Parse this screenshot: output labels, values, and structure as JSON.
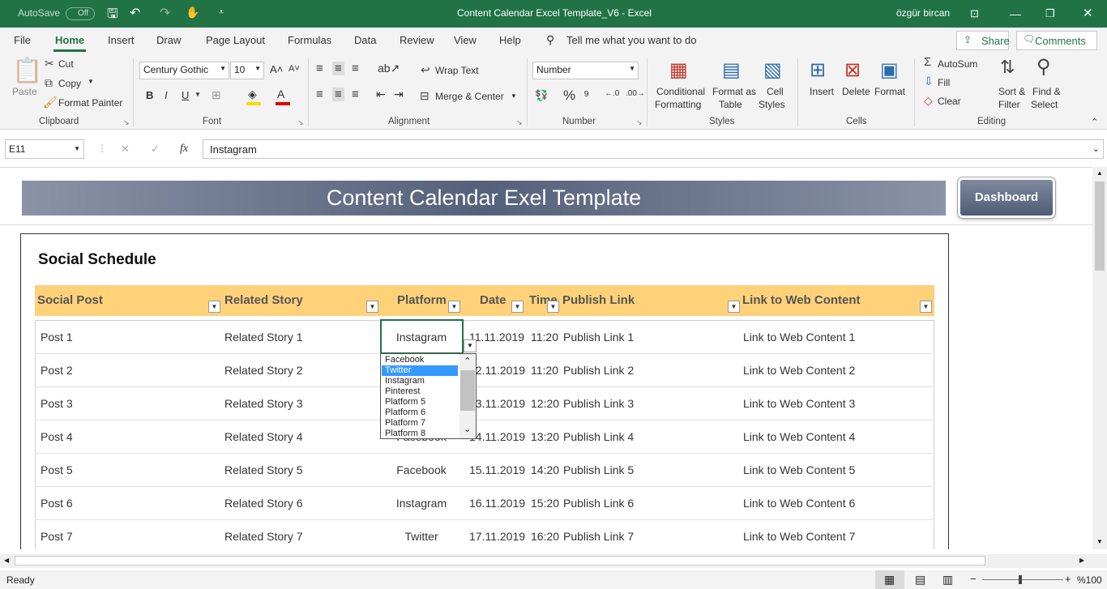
{
  "titlebar": {
    "autosave_label": "AutoSave",
    "autosave_state": "Off",
    "title": "Content Calendar Excel Template_V6  -  Excel",
    "user": "özgür bircan"
  },
  "menu": {
    "tabs": [
      "File",
      "Home",
      "Insert",
      "Draw",
      "Page Layout",
      "Formulas",
      "Data",
      "Review",
      "View",
      "Help"
    ],
    "active": "Home",
    "tell_me": "Tell me what you want to do",
    "share": "Share",
    "comments": "Comments"
  },
  "ribbon": {
    "clipboard": {
      "paste": "Paste",
      "cut": "Cut",
      "copy": "Copy",
      "format_painter": "Format Painter",
      "group": "Clipboard"
    },
    "font": {
      "name": "Century Gothic",
      "size": "10",
      "bold": "B",
      "italic": "I",
      "underline": "U",
      "group": "Font"
    },
    "alignment": {
      "wrap": "Wrap Text",
      "merge": "Merge & Center",
      "group": "Alignment"
    },
    "number": {
      "format": "Number",
      "group": "Number"
    },
    "styles": {
      "conditional_1": "Conditional",
      "conditional_2": "Formatting",
      "table_1": "Format as",
      "table_2": "Table",
      "cell_1": "Cell",
      "cell_2": "Styles",
      "group": "Styles"
    },
    "cells": {
      "insert": "Insert",
      "delete": "Delete",
      "format": "Format",
      "group": "Cells"
    },
    "editing": {
      "autosum": "AutoSum",
      "fill": "Fill",
      "clear": "Clear",
      "sort_1": "Sort &",
      "sort_2": "Filter",
      "find_1": "Find &",
      "find_2": "Select",
      "group": "Editing"
    }
  },
  "formula_bar": {
    "name_box": "E11",
    "fx": "fx",
    "value": "Instagram"
  },
  "sheet": {
    "banner": "Content Calendar Exel Template",
    "dashboard_button": "Dashboard",
    "section_title": "Social Schedule",
    "headers": [
      "Social Post",
      "Related Story",
      "Platform",
      "Date",
      "Time",
      "Publish Link",
      "Link to Web Content"
    ],
    "rows": [
      {
        "post": "Post 1",
        "story": "Related Story 1",
        "platform": "Instagram",
        "date": "11.11.2019",
        "time": "11:20",
        "publish": "Publish Link 1",
        "web": "Link to Web Content 1"
      },
      {
        "post": "Post 2",
        "story": "Related Story 2",
        "platform": "",
        "date": "12.11.2019",
        "time": "11:20",
        "publish": "Publish Link 2",
        "web": "Link to Web Content 2"
      },
      {
        "post": "Post 3",
        "story": "Related Story 3",
        "platform": "",
        "date": "13.11.2019",
        "time": "12:20",
        "publish": "Publish Link 3",
        "web": "Link to Web Content 3"
      },
      {
        "post": "Post 4",
        "story": "Related Story 4",
        "platform": "Facebook",
        "date": "14.11.2019",
        "time": "13:20",
        "publish": "Publish Link 4",
        "web": "Link to Web Content 4"
      },
      {
        "post": "Post 5",
        "story": "Related Story 5",
        "platform": "Facebook",
        "date": "15.11.2019",
        "time": "14:20",
        "publish": "Publish Link 5",
        "web": "Link to Web Content 5"
      },
      {
        "post": "Post 6",
        "story": "Related Story 6",
        "platform": "Instagram",
        "date": "16.11.2019",
        "time": "15:20",
        "publish": "Publish Link 6",
        "web": "Link to Web Content 6"
      },
      {
        "post": "Post 7",
        "story": "Related Story 7",
        "platform": "Twitter",
        "date": "17.11.2019",
        "time": "16:20",
        "publish": "Publish Link 7",
        "web": "Link to Web Content 7"
      }
    ]
  },
  "dropdown": {
    "options": [
      "Facebook",
      "Twitter",
      "Instagram",
      "Pinterest",
      "Platform 5",
      "Platform 6",
      "Platform 7",
      "Platform 8"
    ],
    "highlighted": "Twitter"
  },
  "status": {
    "ready": "Ready",
    "zoom": "%100"
  },
  "colors": {
    "excel_green": "#217346",
    "header_fill": "#ffd27a",
    "banner": "#55607a",
    "highlight": "#3399ff"
  }
}
